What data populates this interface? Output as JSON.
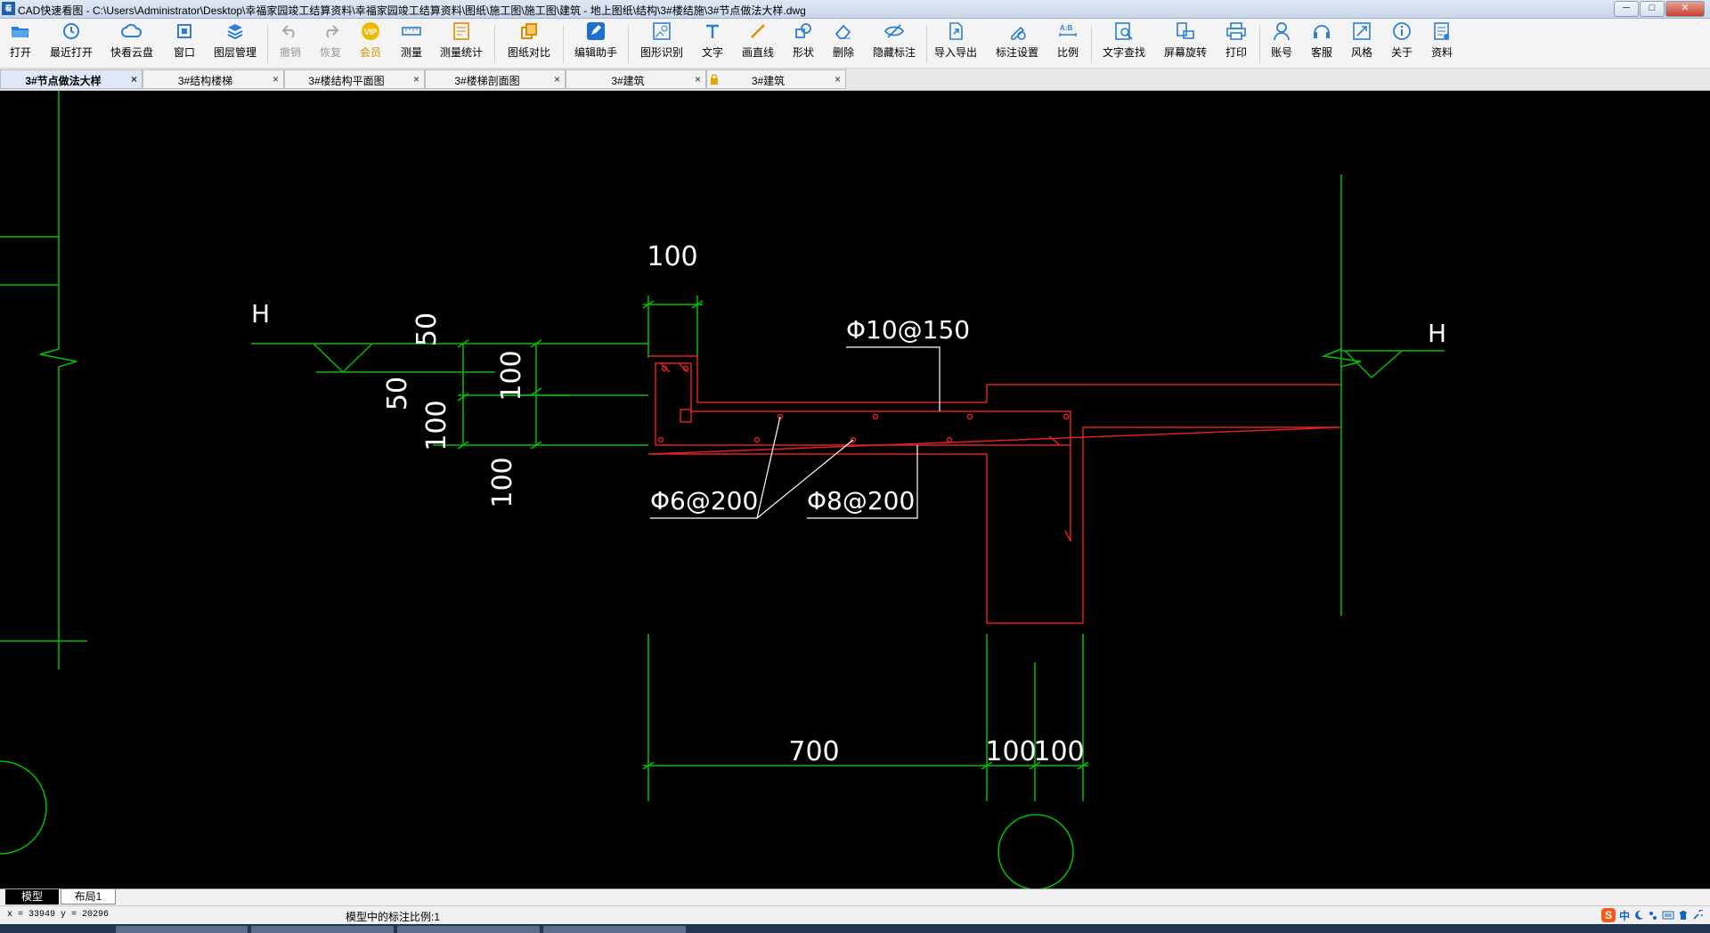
{
  "window": {
    "app_icon": "cad-app-icon",
    "title": "CAD快速看图 - C:\\Users\\Administrator\\Desktop\\幸福家园竣工结算资料\\幸福家园竣工结算资料\\图纸\\施工图\\施工图\\建筑 - 地上图纸\\结构\\3#楼结施\\3#节点做法大样.dwg",
    "buttons": {
      "minimize": "─",
      "maximize": "□",
      "close": "✕"
    }
  },
  "toolbar": {
    "items": [
      {
        "label": "打开",
        "icon": "folder-open-icon"
      },
      {
        "label": "最近打开",
        "icon": "history-icon"
      },
      {
        "label": "快看云盘",
        "icon": "cloud-icon"
      },
      {
        "label": "窗口",
        "icon": "window-icon"
      },
      {
        "label": "图层管理",
        "icon": "layers-icon"
      },
      {
        "label": "撤销",
        "icon": "undo-icon"
      },
      {
        "label": "恢复",
        "icon": "redo-icon"
      },
      {
        "label": "会员",
        "icon": "vip-icon"
      },
      {
        "label": "测量",
        "icon": "ruler-icon"
      },
      {
        "label": "测量统计",
        "icon": "measure-stats-icon"
      },
      {
        "label": "图纸对比",
        "icon": "compare-icon"
      },
      {
        "label": "编辑助手",
        "icon": "edit-assistant-icon"
      },
      {
        "label": "图形识别",
        "icon": "shape-recognize-icon"
      },
      {
        "label": "文字",
        "icon": "text-icon"
      },
      {
        "label": "画直线",
        "icon": "line-icon"
      },
      {
        "label": "形状",
        "icon": "shape-icon"
      },
      {
        "label": "删除",
        "icon": "eraser-icon"
      },
      {
        "label": "隐藏标注",
        "icon": "hide-annotation-icon"
      },
      {
        "label": "导入导出",
        "icon": "import-export-icon"
      },
      {
        "label": "标注设置",
        "icon": "annotation-settings-icon"
      },
      {
        "label": "比例",
        "icon": "scale-icon"
      },
      {
        "label": "文字查找",
        "icon": "text-search-icon"
      },
      {
        "label": "屏幕旋转",
        "icon": "rotate-screen-icon"
      },
      {
        "label": "打印",
        "icon": "printer-icon"
      },
      {
        "label": "账号",
        "icon": "account-icon"
      },
      {
        "label": "客服",
        "icon": "headset-icon"
      },
      {
        "label": "风格",
        "icon": "style-icon"
      },
      {
        "label": "关于",
        "icon": "info-icon"
      },
      {
        "label": "资料",
        "icon": "documents-icon"
      }
    ]
  },
  "tabs": [
    {
      "label": "3#节点做法大样",
      "active": true
    },
    {
      "label": "3#结构楼梯"
    },
    {
      "label": "3#楼结构平面图"
    },
    {
      "label": "3#楼梯剖面图"
    },
    {
      "label": "3#建筑"
    },
    {
      "label": "3#建筑",
      "locked": true
    }
  ],
  "tab_close": "×",
  "drawing": {
    "dims": {
      "top_100": "100",
      "left_50_upper": "50",
      "left_100_inner": "100",
      "left_50_lower": "50",
      "left_100_outer": "100",
      "left_100_bottom": "100",
      "bottom_700": "700",
      "bottom_100_a": "100",
      "bottom_100_b": "100"
    },
    "labels": {
      "level_left": "H",
      "level_right": "H",
      "rebar_top": "Φ10@150",
      "rebar_left": "Φ6@200",
      "rebar_right": "Φ8@200"
    },
    "colors": {
      "background": "#000000",
      "dim_lines": "#00c000",
      "concrete_rebar": "#e02020",
      "text": "#ffffff"
    }
  },
  "layout_tabs": {
    "model": "模型",
    "layout1": "布局1"
  },
  "status": {
    "coords": "x = 33949  y = 20296",
    "scale_text": "模型中的标注比例:1"
  },
  "ime": {
    "logo": "S",
    "lang": "中",
    "icons": [
      "moon-icon",
      "punctuation-icon",
      "keyboard-icon",
      "skin-icon",
      "settings-icon"
    ]
  }
}
